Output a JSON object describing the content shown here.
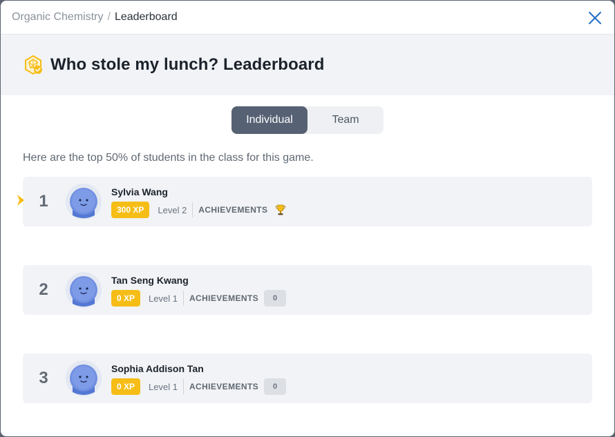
{
  "breadcrumb": {
    "parent": "Organic Chemistry",
    "separator": "/",
    "current": "Leaderboard"
  },
  "header": {
    "title": "Who stole my lunch? Leaderboard"
  },
  "toggle": {
    "individual": "Individual",
    "team": "Team",
    "selected": "Individual"
  },
  "intro": "Here are the top 50% of students in the class for this game.",
  "achievements_label": "ACHIEVEMENTS",
  "rows": [
    {
      "rank": "1",
      "name": "Sylvia Wang",
      "xp": "300 XP",
      "level": "Level 2",
      "achievement": "trophy-icon",
      "current_user": true
    },
    {
      "rank": "2",
      "name": "Tan Seng Kwang",
      "xp": "0 XP",
      "level": "Level 1",
      "achievement_count": "0"
    },
    {
      "rank": "3",
      "name": "Sophia Addison Tan",
      "xp": "0 XP",
      "level": "Level 1",
      "achievement_count": "0"
    }
  ],
  "colors": {
    "xp_badge": "#f6bd16",
    "toggle_active": "#566174",
    "row_bg": "#f1f3f6",
    "close_icon": "#1f6fc5",
    "pointer": "#f6bd16"
  }
}
